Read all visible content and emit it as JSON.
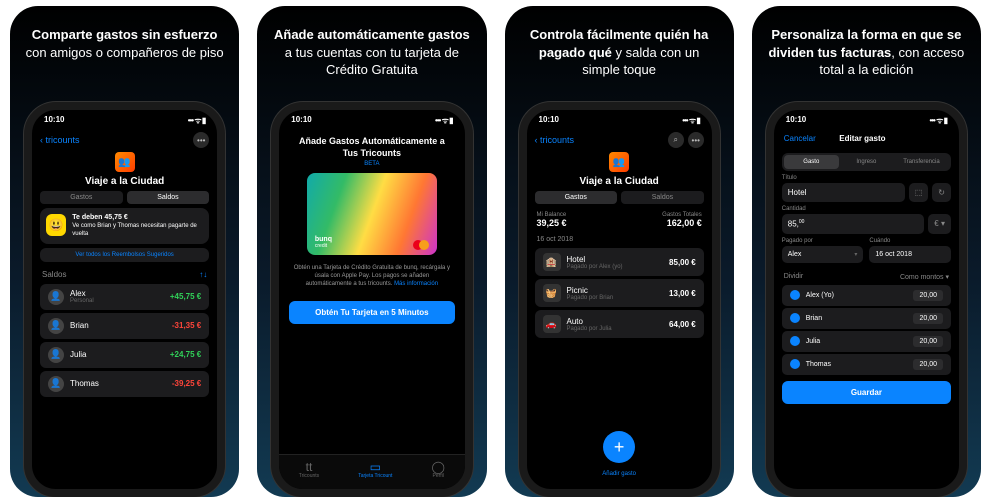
{
  "panels": [
    {
      "headline_bold": "Comparte gastos sin esfuerzo",
      "headline_light": " con amigos o compañeros de piso"
    },
    {
      "headline_bold": "Añade automáticamente gastos",
      "headline_light": " a tus cuentas con tu tarjeta de Crédito Gratuita"
    },
    {
      "headline_bold": "Controla fácilmente quién ha pagado qué",
      "headline_light": " y salda con un simple toque"
    },
    {
      "headline_bold": "Personaliza la forma en que se dividen tus facturas",
      "headline_light": ", con acceso total a la edición"
    }
  ],
  "status": {
    "time": "10:10",
    "signals": "••• ᯤ ▮"
  },
  "s1": {
    "back": "tricounts",
    "title": "Viaje a la Ciudad",
    "tab_gastos": "Gastos",
    "tab_saldos": "Saldos",
    "alert_title": "Te deben 45,75 €",
    "alert_sub": "Ve como Brian y Thomas necesitan pagarte de vuelta",
    "link": "Ver todos los Reembolsos Sugeridos",
    "saldos_label": "Saldos",
    "people": [
      {
        "name": "Alex",
        "sub": "Personal",
        "amount": "+45,75 €",
        "cls": "green"
      },
      {
        "name": "Brian",
        "sub": "",
        "amount": "-31,35 €",
        "cls": "red"
      },
      {
        "name": "Julia",
        "sub": "",
        "amount": "+24,75 €",
        "cls": "green"
      },
      {
        "name": "Thomas",
        "sub": "",
        "amount": "-39,25 €",
        "cls": "red"
      }
    ]
  },
  "s2": {
    "title": "Añade Gastos Automáticamente a Tus Tricounts",
    "sub": "BETA",
    "card_brand": "bunq",
    "card_sub": "credit",
    "desc": "Obtén una Tarjeta de Crédito Gratuita de bunq, recárgala y úsala con Apple Pay. Los pagos se añaden automáticamente a tus tricounts.",
    "more": "Más información",
    "cta": "Obtén Tu Tarjeta en 5 Minutos",
    "nav": [
      "Tricounts",
      "Tarjeta Tricount",
      "Perfil"
    ]
  },
  "s3": {
    "back": "tricounts",
    "title": "Viaje a la Ciudad",
    "tab_gastos": "Gastos",
    "tab_saldos": "Saldos",
    "mi_label": "Mi Balance",
    "mi_val": "39,25 €",
    "total_label": "Gastos Totales",
    "total_val": "162,00 €",
    "date": "16 oct 2018",
    "items": [
      {
        "icon": "🏨",
        "name": "Hotel",
        "sub": "Pagado por Alex (yo)",
        "amount": "85,00 €"
      },
      {
        "icon": "🧺",
        "name": "Picnic",
        "sub": "Pagado por Brian",
        "amount": "13,00 €"
      },
      {
        "icon": "🚗",
        "name": "Auto",
        "sub": "Pagado por Julia",
        "amount": "64,00 €"
      }
    ],
    "fab_label": "Añadir gasto"
  },
  "s4": {
    "cancel": "Cancelar",
    "title": "Editar gasto",
    "seg": [
      "Gasto",
      "Ingreso",
      "Transferencia"
    ],
    "titulo_lbl": "Título",
    "titulo_val": "Hotel",
    "cantidad_lbl": "Cantidad",
    "cantidad_val": "85,",
    "cantidad_dec": "00",
    "currency": "€",
    "pagado_lbl": "Pagado por",
    "pagado_val": "Alex",
    "cuando_lbl": "Cuándo",
    "cuando_val": "16 oct 2018",
    "dividir_lbl": "Dividir",
    "como_lbl": "Como montos",
    "split": [
      {
        "name": "Alex (Yo)",
        "amount": "20,00"
      },
      {
        "name": "Brian",
        "amount": "20,00"
      },
      {
        "name": "Julia",
        "amount": "20,00"
      },
      {
        "name": "Thomas",
        "amount": "20,00"
      }
    ],
    "save": "Guardar"
  }
}
